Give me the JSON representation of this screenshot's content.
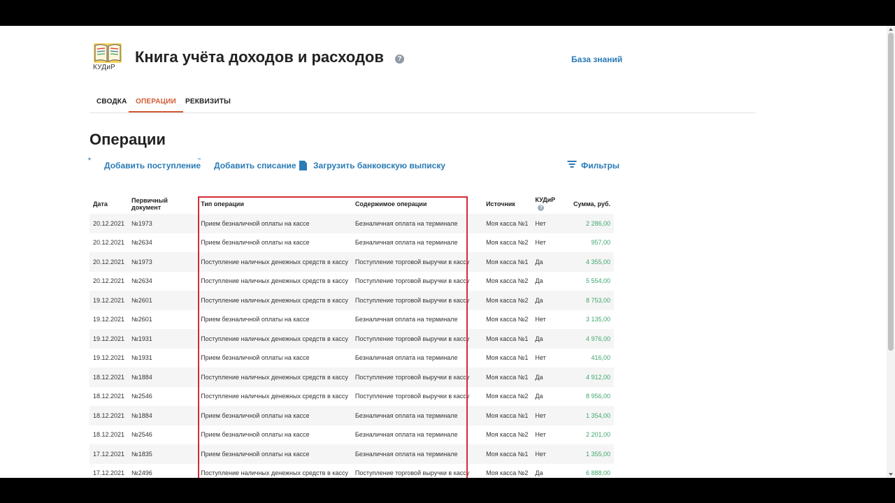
{
  "header": {
    "logo_text": "КУДиР",
    "title": "Книга учёта доходов и расходов",
    "help_glyph": "?",
    "kb_link": "База знаний"
  },
  "tabs": [
    {
      "label": "СВОДКА",
      "active": false
    },
    {
      "label": "ОПЕРАЦИИ",
      "active": true
    },
    {
      "label": "РЕКВИЗИТЫ",
      "active": false
    }
  ],
  "page_title": "Операции",
  "actions": {
    "add_income": "Добавить поступление",
    "add_writeoff": "Добавить списание",
    "upload_statement": "Загрузить банковскую выписку",
    "filters": "Фильтры"
  },
  "table": {
    "columns": [
      "Дата",
      "Первичный документ",
      "Тип операции",
      "Содержимое операции",
      "Источник",
      "КУДиР",
      "Сумма, руб."
    ],
    "rows": [
      [
        "20.12.2021",
        "№1973",
        "Прием безналичной оплаты на кассе",
        "Безналичная оплата на терминале",
        "Моя касса №1",
        "Нет",
        "2 286,00"
      ],
      [
        "20.12.2021",
        "№2634",
        "Прием безналичной оплаты на кассе",
        "Безналичная оплата на терминале",
        "Моя касса №2",
        "Нет",
        "957,00"
      ],
      [
        "20.12.2021",
        "№1973",
        "Поступление наличных денежных средств в кассу",
        "Поступление торговой выручки в кассу",
        "Моя касса №1",
        "Да",
        "4 355,00"
      ],
      [
        "20.12.2021",
        "№2634",
        "Поступление наличных денежных средств в кассу",
        "Поступление торговой выручки в кассу",
        "Моя касса №2",
        "Да",
        "5 554,00"
      ],
      [
        "19.12.2021",
        "№2601",
        "Поступление наличных денежных средств в кассу",
        "Поступление торговой выручки в кассу",
        "Моя касса №2",
        "Да",
        "8 753,00"
      ],
      [
        "19.12.2021",
        "№2601",
        "Прием безналичной оплаты на кассе",
        "Безналичная оплата на терминале",
        "Моя касса №2",
        "Нет",
        "3 135,00"
      ],
      [
        "19.12.2021",
        "№1931",
        "Поступление наличных денежных средств в кассу",
        "Поступление торговой выручки в кассу",
        "Моя касса №1",
        "Да",
        "4 976,00"
      ],
      [
        "19.12.2021",
        "№1931",
        "Прием безналичной оплаты на кассе",
        "Безналичная оплата на терминале",
        "Моя касса №1",
        "Нет",
        "416,00"
      ],
      [
        "18.12.2021",
        "№1884",
        "Поступление наличных денежных средств в кассу",
        "Поступление торговой выручки в кассу",
        "Моя касса №1",
        "Да",
        "4 912,00"
      ],
      [
        "18.12.2021",
        "№2546",
        "Поступление наличных денежных средств в кассу",
        "Поступление торговой выручки в кассу",
        "Моя касса №2",
        "Да",
        "8 956,00"
      ],
      [
        "18.12.2021",
        "№1884",
        "Прием безналичной оплаты на кассе",
        "Безналичная оплата на терминале",
        "Моя касса №1",
        "Нет",
        "1 354,00"
      ],
      [
        "18.12.2021",
        "№2546",
        "Прием безналичной оплаты на кассе",
        "Безналичная оплата на терминале",
        "Моя касса №2",
        "Нет",
        "2 201,00"
      ],
      [
        "17.12.2021",
        "№1835",
        "Прием безналичной оплаты на кассе",
        "Безналичная оплата на терминале",
        "Моя касса №1",
        "Нет",
        "1 355,00"
      ],
      [
        "17.12.2021",
        "№2496",
        "Поступление наличных денежных средств в кассу",
        "Поступление торговой выручки в кассу",
        "Моя касса №2",
        "Да",
        "6 888,00"
      ]
    ]
  },
  "colors": {
    "accent": "#2a7bb6",
    "active_tab": "#d05b36",
    "amount": "#3fa66b",
    "highlight": "#d32a35"
  }
}
